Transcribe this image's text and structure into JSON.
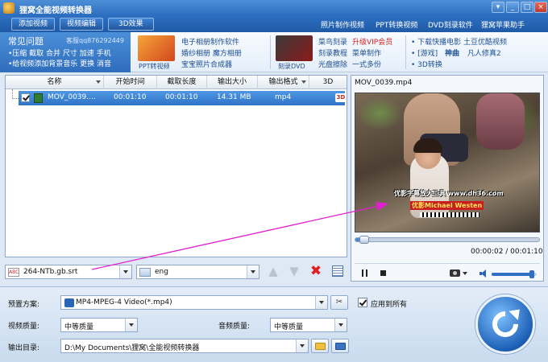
{
  "app": {
    "title": "狸窝全能视频转换器"
  },
  "toolbar": {
    "add_video": "添加视频",
    "edit_video": "视频编辑",
    "effect_3d": "3D效果",
    "links": [
      "照片制作视频",
      "PPT转换视频",
      "DVD刻录软件",
      "狸窝苹果助手"
    ]
  },
  "faq": {
    "title": "常见问题",
    "qq": "客服qq876292449",
    "line1": "•压缩  截取  合并  尺寸  加速  手机",
    "line2": "•给视频添加背景音乐  更换  消音"
  },
  "promos": {
    "ppt_caption": "PPT转视频",
    "dvd_caption": "刻录DVD",
    "col1": [
      "电子相册制作软件",
      "婚纱相册  魔方相册",
      "宝宝照片合成器"
    ],
    "col2a": [
      "菜鸟刻录",
      "刻录教程",
      "光盘擦除"
    ],
    "col2b": [
      "升级VIP会员",
      "菜单制作",
      "一式多份"
    ],
    "col3": [
      "• 下载快播电影  土豆优酷视频",
      "• [游戏]",
      "神曲",
      "凡人修真2",
      "• 3D转换"
    ]
  },
  "file_list": {
    "columns": [
      "名称",
      "开始时间",
      "截取长度",
      "输出大小",
      "输出格式",
      "3D"
    ],
    "rows": [
      {
        "name": "MOV_0039....",
        "start": "00:01:10",
        "length": "00:01:10",
        "size": "14.31 MB",
        "format": "mp4",
        "badge_3d": "3D"
      }
    ],
    "subtitle": "264-NTb.gb.srt",
    "audio_track": "eng"
  },
  "preview": {
    "title": "MOV_0039.mp4",
    "caption_line1": "优影字幕放大工具  www.dh36.com",
    "caption_line2": "优影Michael Westen",
    "time_display": "00:00:02 / 00:01:10",
    "progress_fraction": 0.03,
    "volume_fraction": 0.95
  },
  "settings": {
    "preset_label": "预置方案:",
    "preset_value": "MP4-MPEG-4 Video(*.mp4)",
    "apply_all_label": "应用到所有",
    "apply_all_checked": true,
    "video_quality_label": "视频质量:",
    "video_quality_value": "中等质量",
    "audio_quality_label": "音频质量:",
    "audio_quality_value": "中等质量",
    "output_label": "输出目录:",
    "output_value": "D:\\My Documents\\狸窝\\全能视频转换器"
  },
  "colors": {
    "accent": "#2f74c8",
    "title_bar": "#3a7bc8",
    "annotation_arrow": "#e020d0"
  }
}
